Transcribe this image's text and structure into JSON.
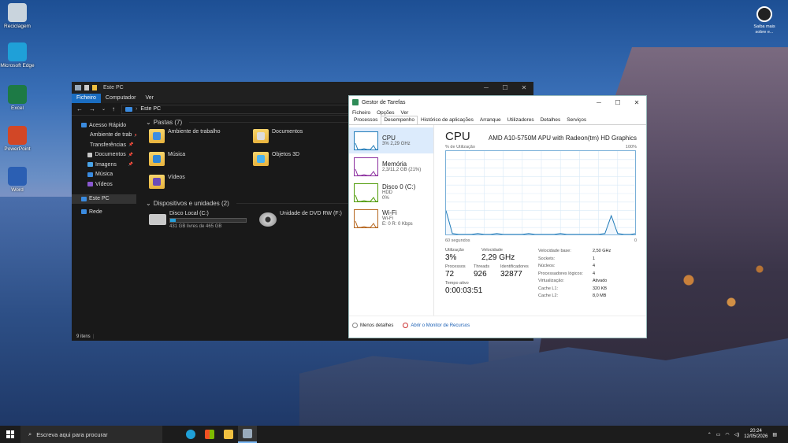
{
  "desktop": {
    "icons": [
      {
        "label": "Reciclagem",
        "color": "#c9d4dd"
      },
      {
        "label": "Microsoft Edge",
        "color": "#1fa0d8"
      },
      {
        "label": "Excel",
        "color": "#1d7a45"
      },
      {
        "label": "PowerPoint",
        "color": "#d24726"
      },
      {
        "label": "Word",
        "color": "#2b5fb3"
      }
    ],
    "saiba_mais": "Saiba mais sobre e..."
  },
  "explorer": {
    "title": "Este PC",
    "ribbon": [
      "Ficheiro",
      "Computador",
      "Ver"
    ],
    "address": "Este PC",
    "nav": [
      {
        "label": "Acesso Rápido",
        "color": "#3a8be0"
      },
      {
        "label": "Ambiente de trab",
        "color": "#3a8be0",
        "pin": true
      },
      {
        "label": "Transferências",
        "color": "#2fa6df",
        "pin": true
      },
      {
        "label": "Documentos",
        "color": "#c8c8c8",
        "pin": true
      },
      {
        "label": "Imagens",
        "color": "#4aa4e8",
        "pin": true
      },
      {
        "label": "Música",
        "color": "#3a8be0"
      },
      {
        "label": "Vídeos",
        "color": "#8a58d0"
      },
      {
        "label": "Este PC",
        "color": "#3a8be0",
        "selected": true
      },
      {
        "label": "Rede",
        "color": "#3a8be0"
      }
    ],
    "folders_header": "Pastas (7)",
    "folders": [
      {
        "label": "Ambiente de trabalho",
        "tint": "#3d8de0"
      },
      {
        "label": "Documentos",
        "tint": "#dcdcdc"
      },
      {
        "label": "Música",
        "tint": "#2f86d6"
      },
      {
        "label": "Objetos 3D",
        "tint": "#4bb3f0"
      },
      {
        "label": "Vídeos",
        "tint": "#6a4bb8"
      }
    ],
    "devices_header": "Dispositivos e unidades (2)",
    "drives": [
      {
        "label": "Disco Local (C:)",
        "info": "431 GB livres de 465 GB",
        "used_fraction": 0.073
      },
      {
        "label": "Unidade de DVD RW (F:)",
        "info": ""
      }
    ],
    "status": "9 itens"
  },
  "taskmgr": {
    "title": "Gestor de Tarefas",
    "menu": [
      "Ficheiro",
      "Opções",
      "Ver"
    ],
    "tabs": [
      "Processos",
      "Desempenho",
      "Histórico de aplicações",
      "Arranque",
      "Utilizadores",
      "Detalhes",
      "Serviços"
    ],
    "active_tab": "Desempenho",
    "resources": [
      {
        "name": "CPU",
        "sub1": "3% 2,29 GHz",
        "sub2": "",
        "color": "#1f7ab8",
        "selected": true
      },
      {
        "name": "Memória",
        "sub1": "2,3/11,2 GB (21%)",
        "sub2": "",
        "color": "#8b2d9e"
      },
      {
        "name": "Disco 0 (C:)",
        "sub1": "HDD",
        "sub2": "0%",
        "color": "#4e9a06"
      },
      {
        "name": "Wi-Fi",
        "sub1": "Wi-Fi",
        "sub2": "E: 0 R: 0 Kbps",
        "color": "#b5651d"
      }
    ],
    "heading": "CPU",
    "model": "AMD A10-5750M APU with Radeon(tm) HD Graphics",
    "graph_label_left": "% de Utilização",
    "graph_label_right": "100%",
    "graph_time_left": "60 segundos",
    "graph_time_right": "0",
    "stats": {
      "utilizacao_label": "Utilização",
      "utilizacao": "3%",
      "velocidade_label": "Velocidade",
      "velocidade": "2,29 GHz",
      "processos_label": "Processos",
      "processos": "72",
      "threads_label": "Threads",
      "threads": "926",
      "identificadores_label": "Identificadores",
      "identificadores": "32877",
      "tempo_label": "Tempo ativo",
      "tempo": "0:00:03:51"
    },
    "specs": [
      {
        "k": "Velocidade base:",
        "v": "2,50 GHz"
      },
      {
        "k": "Sockets:",
        "v": "1"
      },
      {
        "k": "Núcleos:",
        "v": "4"
      },
      {
        "k": "Processadores lógicos:",
        "v": "4"
      },
      {
        "k": "Virtualização:",
        "v": "Ativado"
      },
      {
        "k": "Cache L1:",
        "v": "320 KB"
      },
      {
        "k": "Cache L2:",
        "v": "8,0 MB"
      }
    ],
    "footer_less": "Menos detalhes",
    "footer_monitor": "Abrir o Monitor de Recursos"
  },
  "chart_data": {
    "type": "line",
    "x": [
      0,
      2,
      4,
      6,
      8,
      10,
      12,
      14,
      16,
      18,
      20,
      22,
      24,
      26,
      28,
      30,
      32,
      34,
      36,
      38,
      40,
      42,
      44,
      46,
      48,
      50,
      52,
      54,
      56,
      58,
      60
    ],
    "series": [
      {
        "values": [
          30,
          3,
          2,
          2,
          2,
          3,
          2,
          2,
          3,
          2,
          2,
          2,
          2,
          3,
          2,
          2,
          2,
          2,
          3,
          2,
          2,
          2,
          2,
          2,
          2,
          3,
          24,
          3,
          2,
          2,
          3
        ]
      }
    ],
    "ylim": [
      0,
      100
    ],
    "xlim": [
      0,
      60
    ]
  },
  "taskbar": {
    "search_placeholder": "Escreva aqui para procurar",
    "time": "20:24",
    "date": "12/05/2026"
  }
}
